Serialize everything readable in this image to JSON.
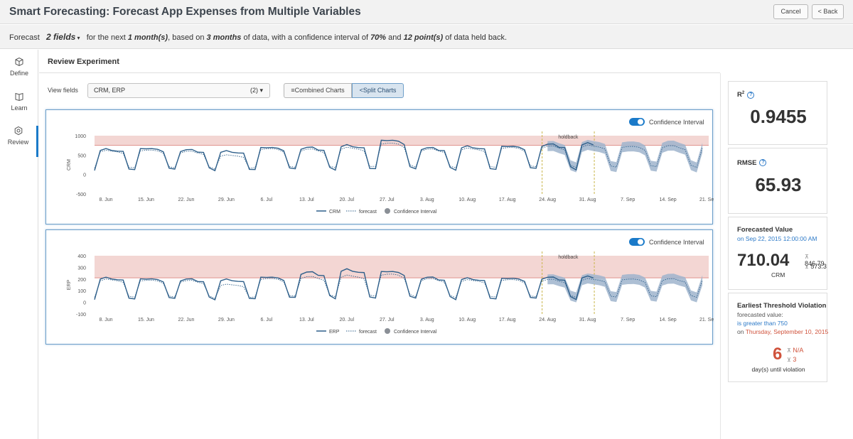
{
  "header": {
    "title": "Smart Forecasting: Forecast App Expenses from Multiple Variables",
    "cancel_label": "Cancel",
    "back_label": "< Back"
  },
  "summary": {
    "prefix": "Forecast",
    "fields_value": "2 fields",
    "t1": "for the next",
    "horizon": "1 month(s)",
    "t2": ", based on",
    "history": "3 months",
    "t3": "of data, with a confidence interval of",
    "confidence": "70%",
    "t4": "and",
    "holdback": "12 point(s)",
    "t5": "of data held back."
  },
  "sidebar": {
    "items": [
      {
        "label": "Define",
        "icon": "box-icon"
      },
      {
        "label": "Learn",
        "icon": "book-icon"
      },
      {
        "label": "Review",
        "icon": "gear-icon"
      }
    ]
  },
  "review": {
    "title": "Review Experiment",
    "view_fields_label": "View fields",
    "view_fields_value": "CRM, ERP",
    "view_fields_count": "(2)",
    "combined_label": "Combined Charts",
    "split_label": "Split Charts"
  },
  "x_ticks": [
    "8. Jun",
    "15. Jun",
    "22. Jun",
    "29. Jun",
    "6. Jul",
    "13. Jul",
    "20. Jul",
    "27. Jul",
    "3. Aug",
    "10. Aug",
    "17. Aug",
    "24. Aug",
    "31. Aug",
    "7. Sep",
    "14. Sep",
    "21. Sep"
  ],
  "chart_data": [
    {
      "type": "line",
      "ylabel": "CRM",
      "y_ticks": [
        "1000",
        "500",
        "0",
        "-500"
      ],
      "ylim": [
        -500,
        1000
      ],
      "threshold_band": [
        750,
        1000
      ],
      "holdback_label": "holdback",
      "toggle_label": "Confidence Interval",
      "legend": [
        "CRM",
        "forecast",
        "Confidence Interval"
      ],
      "week_peak": [
        650,
        680,
        640,
        600,
        710,
        700,
        750,
        900,
        690,
        720,
        740,
        780,
        800,
        790,
        790,
        790
      ],
      "forecast_peak": [
        640,
        660,
        620,
        520,
        700,
        680,
        720,
        850,
        680,
        700,
        730,
        760,
        780,
        760,
        770,
        760
      ],
      "trough": 50
    },
    {
      "type": "line",
      "ylabel": "ERP",
      "y_ticks": [
        "400",
        "300",
        "200",
        "100",
        "0",
        "-100"
      ],
      "ylim": [
        -100,
        400
      ],
      "threshold_band": [
        210,
        400
      ],
      "holdback_label": "holdback",
      "toggle_label": "Confidence Interval",
      "legend": [
        "ERP",
        "forecast",
        "Confidence Interval"
      ],
      "week_peak": [
        210,
        205,
        200,
        195,
        220,
        260,
        280,
        270,
        215,
        205,
        210,
        215,
        220,
        225,
        225,
        220
      ],
      "forecast_peak": [
        205,
        200,
        195,
        160,
        215,
        230,
        240,
        255,
        210,
        200,
        205,
        205,
        210,
        210,
        210,
        210
      ],
      "trough": 5
    }
  ],
  "cards": {
    "r2_label": "R",
    "r2_sup": "2",
    "r2_value": "0.9455",
    "rmse_label": "RMSE",
    "rmse_value": "65.93",
    "forecast_label": "Forecasted Value",
    "forecast_date": "on Sep 22, 2015 12:00:00 AM",
    "forecast_value": "710.04",
    "forecast_field": "CRM",
    "forecast_upper": "846.79",
    "forecast_lower": "573.3",
    "violation_label": "Earliest Threshold Violation",
    "violation_t1": "forecasted value:",
    "violation_t2": "is greater than 750",
    "violation_t3": "on",
    "violation_date": "Thursday, September 10, 2015",
    "violation_days": "6",
    "violation_upper": "N/A",
    "violation_lower": "3",
    "violation_caption": "day(s) until violation"
  },
  "colors": {
    "accent": "#1a7ac9",
    "series": "#2e5f8a",
    "band": "#f3d6d3",
    "threshold": "#e0928c",
    "ci": "#9fb4cc",
    "holdback": "#c9b64a",
    "violation": "#d0533c"
  }
}
